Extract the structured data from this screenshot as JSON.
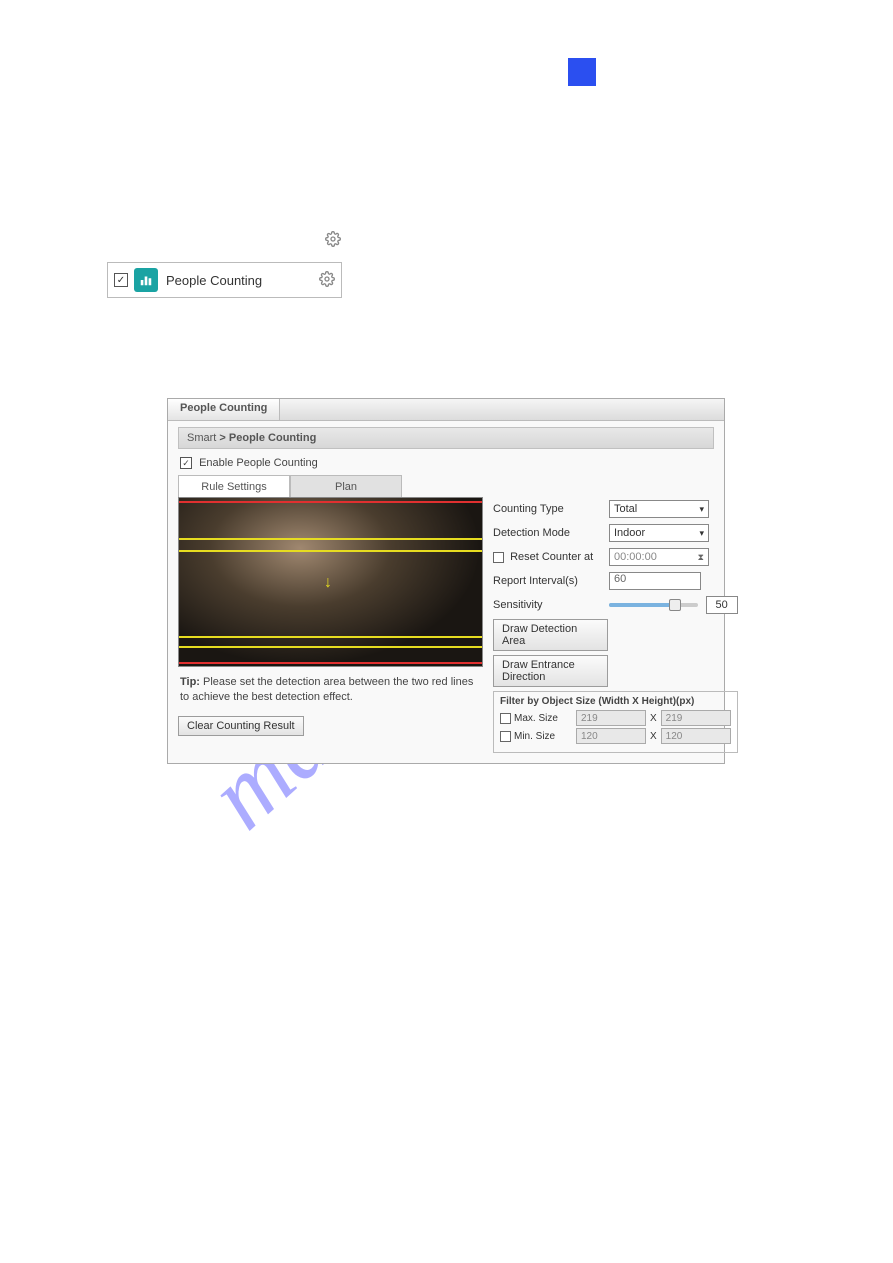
{
  "feature": {
    "label": "People Counting"
  },
  "dialog": {
    "title": "People Counting",
    "breadcrumb": {
      "root": "Smart",
      "sep": ">",
      "current": "People Counting"
    },
    "enable_label": "Enable People Counting",
    "tabs": {
      "rule": "Rule Settings",
      "plan": "Plan"
    },
    "tip_label": "Tip:",
    "tip_text": "Please set the detection area between the two red lines to achieve the best detection effect.",
    "clear_button": "Clear Counting Result"
  },
  "form": {
    "counting_type": {
      "label": "Counting Type",
      "value": "Total"
    },
    "detection_mode": {
      "label": "Detection Mode",
      "value": "Indoor"
    },
    "reset_counter": {
      "label": "Reset Counter at",
      "value": "00:00:00"
    },
    "report_interval": {
      "label": "Report Interval(s)",
      "value": "60"
    },
    "sensitivity": {
      "label": "Sensitivity",
      "value": "50",
      "percent": 50
    },
    "draw_area": "Draw Detection Area",
    "draw_direction": "Draw Entrance Direction",
    "filter": {
      "title": "Filter by Object Size (Width X Height)(px)",
      "max_label": "Max. Size",
      "max_w": "219",
      "max_h": "219",
      "min_label": "Min. Size",
      "min_w": "120",
      "min_h": "120",
      "x": "X"
    }
  }
}
